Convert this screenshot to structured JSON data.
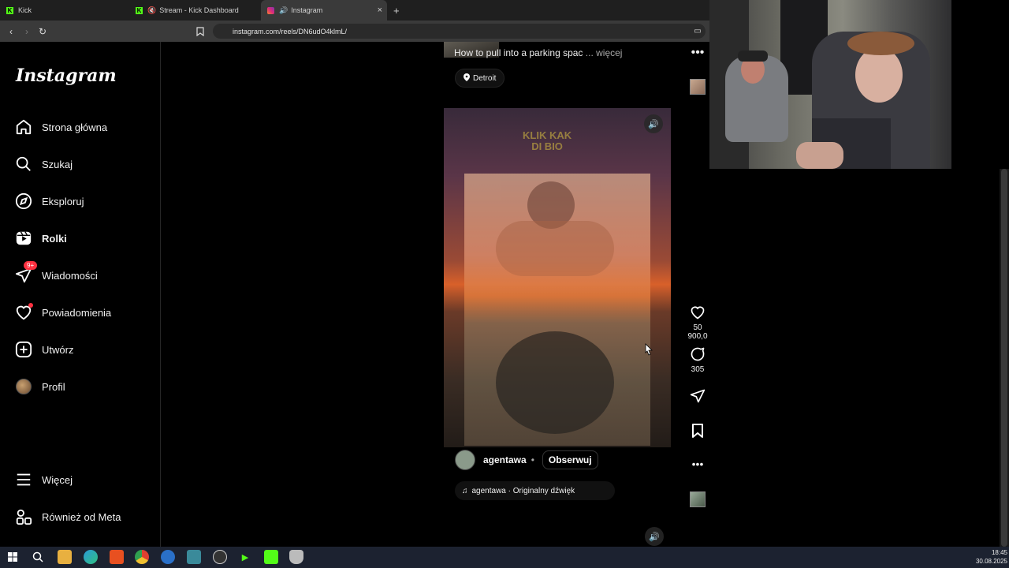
{
  "browser": {
    "tabs": [
      {
        "label": "Kick",
        "favicon": "kick-icon"
      },
      {
        "label": "Stream - Kick Dashboard",
        "favicon": "kick-icon"
      },
      {
        "label": "Instagram",
        "favicon": "instagram-icon",
        "active": true
      }
    ],
    "new_tab": "+",
    "close_tab": "×",
    "url": "instagram.com/reels/DN6udO4klmL/"
  },
  "sidebar": {
    "logo": "Instagram",
    "items": [
      {
        "label": "Strona główna",
        "icon": "home-icon"
      },
      {
        "label": "Szukaj",
        "icon": "search-icon"
      },
      {
        "label": "Eksploruj",
        "icon": "compass-icon"
      },
      {
        "label": "Rolki",
        "icon": "reels-icon",
        "active": true
      },
      {
        "label": "Wiadomości",
        "icon": "messenger-icon",
        "badge": "9+"
      },
      {
        "label": "Powiadomienia",
        "icon": "heart-icon",
        "dot": true
      },
      {
        "label": "Utwórz",
        "icon": "plus-square-icon"
      },
      {
        "label": "Profil",
        "icon": "avatar"
      }
    ],
    "bottom": [
      {
        "label": "Więcej",
        "icon": "menu-icon"
      },
      {
        "label": "Również od Meta",
        "icon": "meta-apps-icon"
      }
    ]
  },
  "reel_prev": {
    "caption": "How to pull into a parking spac",
    "more": "... więcej",
    "location": "Detroit"
  },
  "reel": {
    "video_title_line1": "KLIK KAK",
    "video_title_line2": "DI BIO",
    "author": "agentawa",
    "separator": "•",
    "follow_label": "Obserwuj",
    "audio": "agentawa · Originalny dźwięk",
    "likes": "50 900,0",
    "comments": "305"
  },
  "taskbar": {
    "time": "18:45",
    "date": "30.08.2025"
  },
  "colors": {
    "accent_red": "#ff3040",
    "background": "#000000"
  }
}
